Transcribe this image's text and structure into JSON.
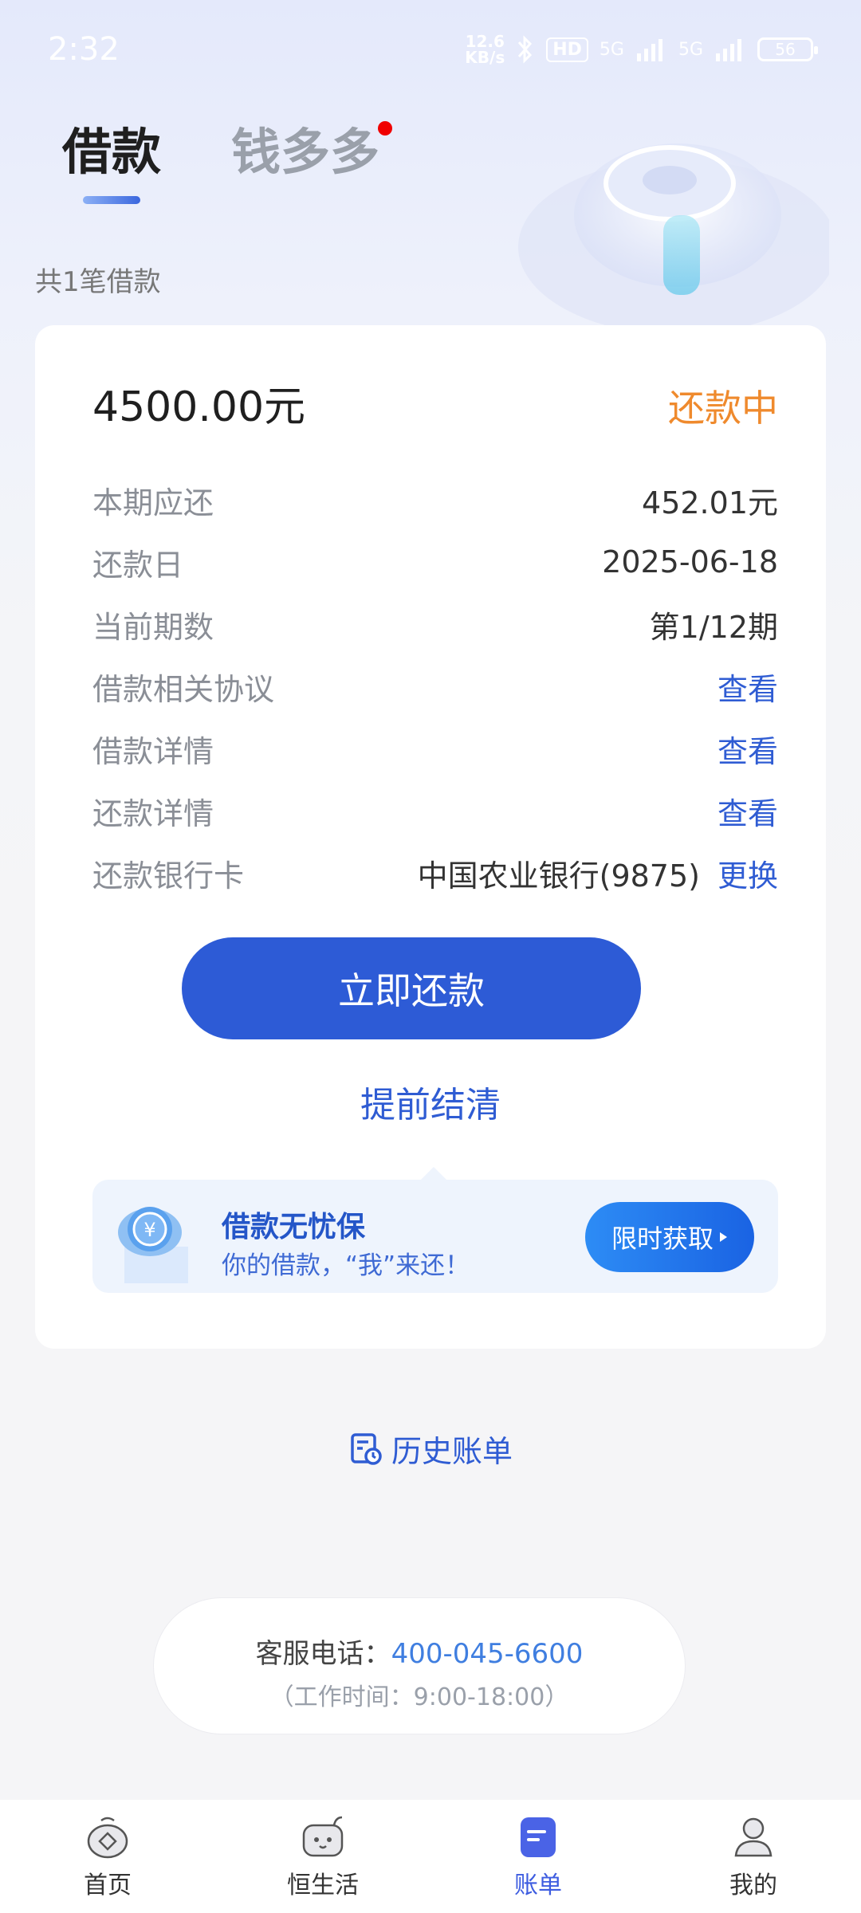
{
  "status_bar": {
    "time": "2:32",
    "net_speed_value": "12.6",
    "net_speed_unit": "KB/s",
    "hd_badge": "HD",
    "signal_1": "5G",
    "signal_2": "5G",
    "battery": "56"
  },
  "tabs": [
    {
      "label": "借款",
      "active": true
    },
    {
      "label": "钱多多",
      "active": false,
      "has_dot": true
    }
  ],
  "loan_count": "共1笔借款",
  "loan": {
    "amount": "4500.00元",
    "status": "还款中",
    "rows": [
      {
        "label": "本期应还",
        "value": "452.01元"
      },
      {
        "label": "还款日",
        "value": "2025-06-18"
      },
      {
        "label": "当前期数",
        "value": "第1/12期"
      },
      {
        "label": "借款相关协议",
        "link": "查看"
      },
      {
        "label": "借款详情",
        "link": "查看"
      },
      {
        "label": "还款详情",
        "link": "查看"
      },
      {
        "label": "还款银行卡",
        "value": "中国农业银行(9875)",
        "link": "更换"
      }
    ],
    "repay_button": "立即还款",
    "early_settle": "提前结清"
  },
  "promo": {
    "title": "借款无忧保",
    "subtitle": "你的借款，“我”来还！",
    "button": "限时获取",
    "icon_text": "¥"
  },
  "history_link": "历史账单",
  "service": {
    "label": "客服电话：",
    "phone": "400-045-6600",
    "hours": "（工作时间：9:00-18:00）"
  },
  "bottom_nav": [
    {
      "label": "首页",
      "icon": "home-icon",
      "active": false
    },
    {
      "label": "恒生活",
      "icon": "life-icon",
      "active": false
    },
    {
      "label": "账单",
      "icon": "bill-icon",
      "active": true
    },
    {
      "label": "我的",
      "icon": "profile-icon",
      "active": false
    }
  ],
  "colors": {
    "primary": "#2d5bd6",
    "link": "#2f5cd3",
    "status_orange": "#ef8a2d",
    "red_dot": "#f00000"
  }
}
